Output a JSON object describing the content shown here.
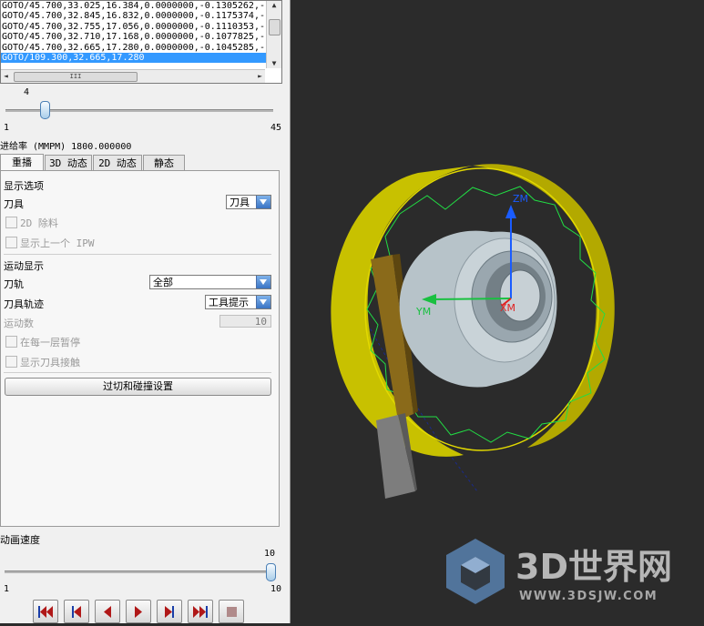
{
  "cl_lines": [
    "GOTO/45.700,33.025,16.384,0.0000000,-0.1305262,-",
    "GOTO/45.700,32.845,16.832,0.0000000,-0.1175374,-",
    "GOTO/45.700,32.755,17.056,0.0000000,-0.1110353,-",
    "GOTO/45.700,32.710,17.168,0.0000000,-0.1077825,-",
    "GOTO/45.700,32.665,17.280,0.0000000,-0.1045285,-",
    "GOTO/109.300,32.665,17.280"
  ],
  "scroll": {
    "hthumb": "III",
    "up": "▲",
    "down": "▼",
    "left": "◄",
    "right": "►"
  },
  "step_slider": {
    "current": "4",
    "min": "1",
    "max": "45",
    "fraction": 0.068
  },
  "feedrate": "进给率 (MMPM) 1800.000000",
  "tabs": [
    "重播",
    "3D 动态",
    "2D 动态",
    "静态"
  ],
  "display": {
    "header": "显示选项",
    "tool_label": "刀具",
    "tool_value": "刀具",
    "chk_2d": "2D 除料",
    "chk_ipw": "显示上一个 IPW"
  },
  "motion": {
    "header": "运动显示",
    "path_label": "刀轨",
    "path_value": "全部",
    "trace_label": "刀具轨迹",
    "trace_value": "工具提示",
    "count_label": "运动数",
    "count_value": "10",
    "chk_pause": "在每一层暂停",
    "chk_contact": "显示刀具接触",
    "button": "过切和碰撞设置"
  },
  "anim": {
    "label": "动画速度",
    "current": "10",
    "min": "1",
    "max": "10",
    "fraction": 1.0
  },
  "axes": {
    "z": "ZM",
    "y": "YM",
    "x": "XM"
  },
  "watermark": {
    "brand": "3D世界网",
    "url": "WWW.3DSJW.COM"
  },
  "colors": {
    "ring": "#c8c100",
    "toolpath": "#22dd44",
    "hub": "#b7c3c9",
    "z_axis": "#1a5cff",
    "y_axis": "#19c040",
    "x_axis": "#e02020",
    "tool": "#8a6a1a",
    "selection": "#3399ff"
  }
}
